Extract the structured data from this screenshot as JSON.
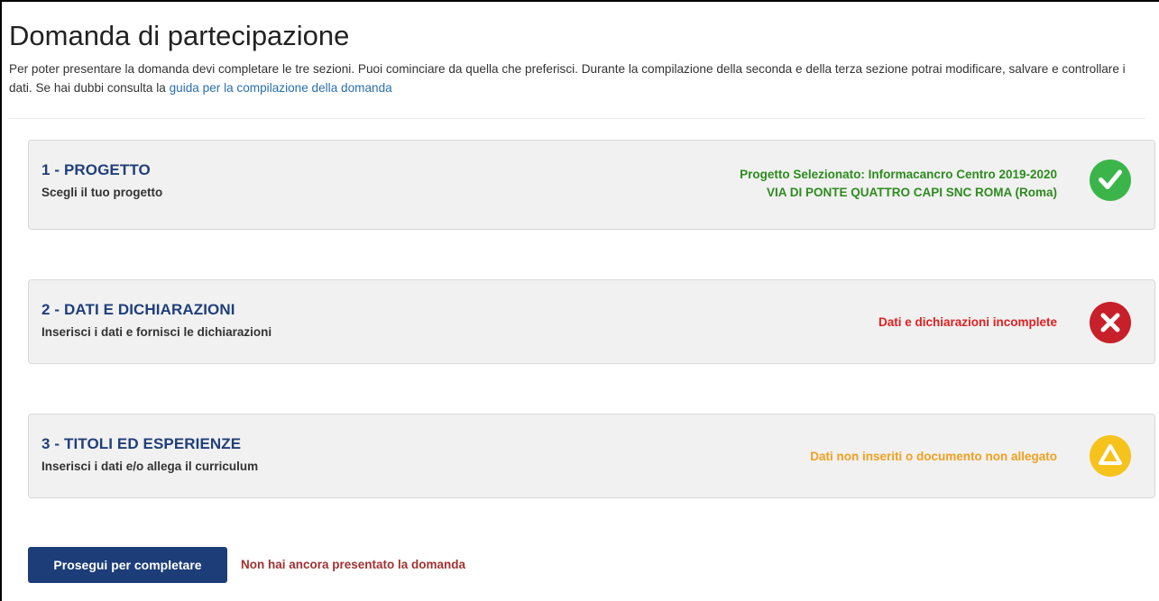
{
  "page": {
    "title": "Domanda di partecipazione",
    "intro_text": "Per poter presentare la domanda devi completare le tre sezioni. Puoi cominciare da quella che preferisci. Durante la compilazione della seconda e della terza sezione potrai modificare, salvare e controllare i dati. Se hai dubbi consulta la ",
    "guide_link": "guida per la compilazione della domanda"
  },
  "sections": [
    {
      "title": "1 - PROGETTO",
      "subtitle": "Scegli il tuo progetto",
      "status_line1": "Progetto Selezionato: Informacancro Centro 2019-2020",
      "status_line2": "VIA DI PONTE QUATTRO CAPI SNC ROMA (Roma)",
      "status_color": "#2e8b1f",
      "icon": "check-icon",
      "icon_color": "#3bb54a"
    },
    {
      "title": "2 - DATI E DICHIARAZIONI",
      "subtitle": "Inserisci i dati e fornisci le dichiarazioni",
      "status_line1": "Dati e dichiarazioni incomplete",
      "status_color": "#e02020",
      "icon": "close-icon",
      "icon_color": "#c8202a"
    },
    {
      "title": "3 - TITOLI ED ESPERIENZE",
      "subtitle": "Inserisci i dati e/o allega il curriculum",
      "status_line1": "Dati non inseriti o documento non allegato",
      "status_color": "#f0a020",
      "icon": "warning-triangle-icon",
      "icon_color": "#f6c31c"
    }
  ],
  "footer": {
    "continue_button": "Prosegui per completare",
    "status_message": "Non hai ancora presentato la domanda"
  }
}
